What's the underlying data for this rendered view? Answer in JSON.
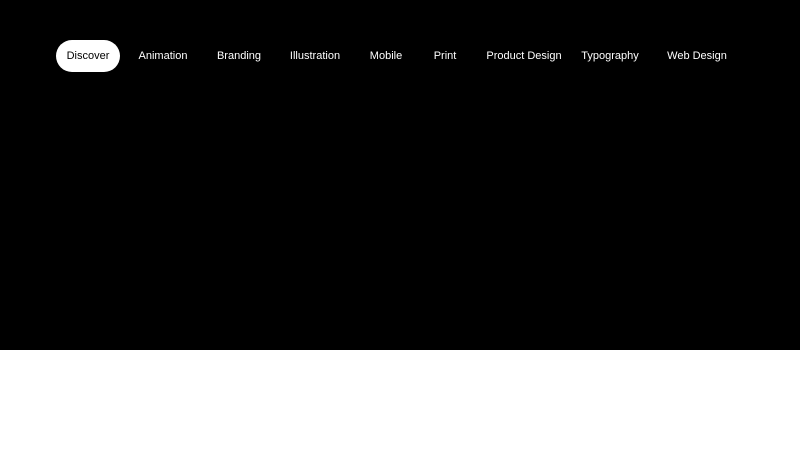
{
  "nav": {
    "items": [
      {
        "label": "Discover",
        "active": true
      },
      {
        "label": "Animation",
        "active": false
      },
      {
        "label": "Branding",
        "active": false
      },
      {
        "label": "Illustration",
        "active": false
      },
      {
        "label": "Mobile",
        "active": false
      },
      {
        "label": "Print",
        "active": false
      },
      {
        "label": "Product Design",
        "active": false
      },
      {
        "label": "Typography",
        "active": false
      },
      {
        "label": "Web Design",
        "active": false
      }
    ]
  },
  "colors": {
    "hero_background": "#000000",
    "page_background": "#ffffff",
    "active_pill": "#ffffff",
    "text_on_dark": "#ffffff",
    "text_on_light": "#000000"
  }
}
